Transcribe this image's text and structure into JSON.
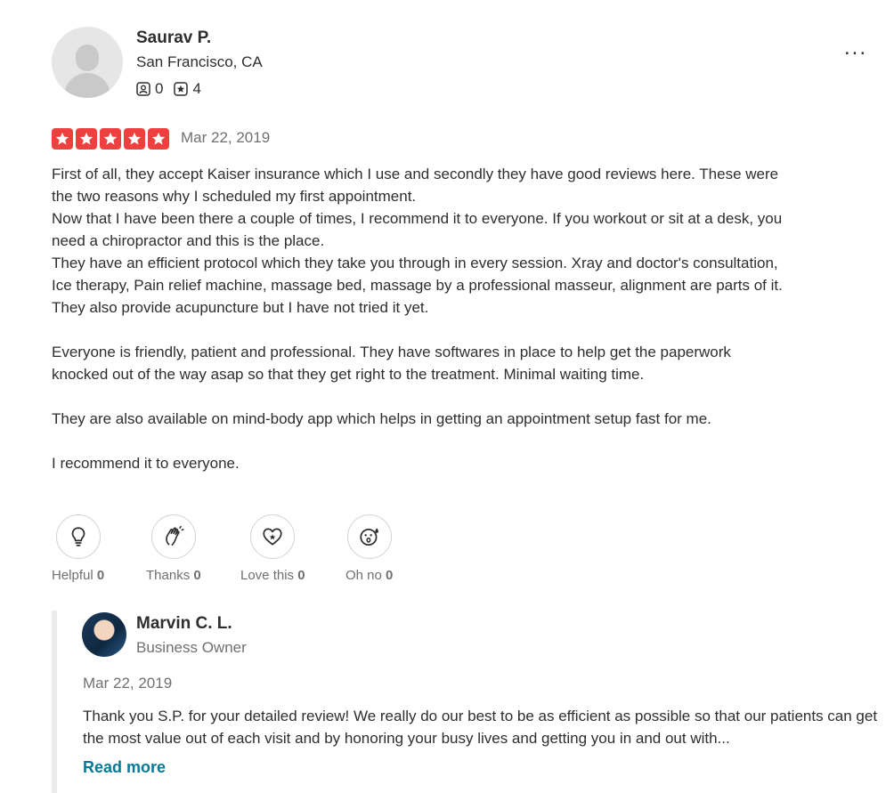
{
  "reviewer": {
    "name": "Saurav P.",
    "location": "San Francisco, CA",
    "friends_count": "0",
    "reviews_count": "4"
  },
  "review": {
    "rating": 5,
    "rating_max": 5,
    "star_color": "#ef4040",
    "date": "Mar 22, 2019",
    "paragraphs": [
      "First of all, they accept Kaiser insurance which I use and secondly they have good reviews here. These were the two reasons why I scheduled my first appointment.\nNow that I have been there a couple of times, I recommend it to everyone. If you workout or sit at a desk, you need a chiropractor and this is the place.\nThey have an efficient protocol which they take you through in every session. Xray and doctor's consultation, Ice therapy, Pain relief machine, massage bed, massage by a professional masseur, alignment are parts of it. They also provide acupuncture but I have not tried it yet.",
      "Everyone is friendly, patient and professional. They have softwares in place to help get the paperwork knocked out of the way asap so that they get right to the treatment. Minimal waiting time.",
      "They are also available on mind-body app which helps in getting an appointment setup fast for me.",
      "I recommend it to everyone."
    ]
  },
  "reactions": [
    {
      "label": "Helpful",
      "count": "0",
      "icon": "lightbulb-icon"
    },
    {
      "label": "Thanks",
      "count": "0",
      "icon": "clapping-hands-icon"
    },
    {
      "label": "Love this",
      "count": "0",
      "icon": "heart-icon"
    },
    {
      "label": "Oh no",
      "count": "0",
      "icon": "surprised-face-icon"
    }
  ],
  "owner_reply": {
    "name": "Marvin C. L.",
    "role": "Business Owner",
    "date": "Mar 22, 2019",
    "text": "Thank you S.P. for your detailed review! We really do our best to be as efficient as possible so that our patients can get the most value out of each visit and by honoring your busy lives and getting you in and out with...",
    "read_more": "Read more"
  },
  "menu": {
    "more_label": "..."
  },
  "colors": {
    "link": "#027a97",
    "text": "#2d2e2f",
    "muted": "#6e7072"
  }
}
